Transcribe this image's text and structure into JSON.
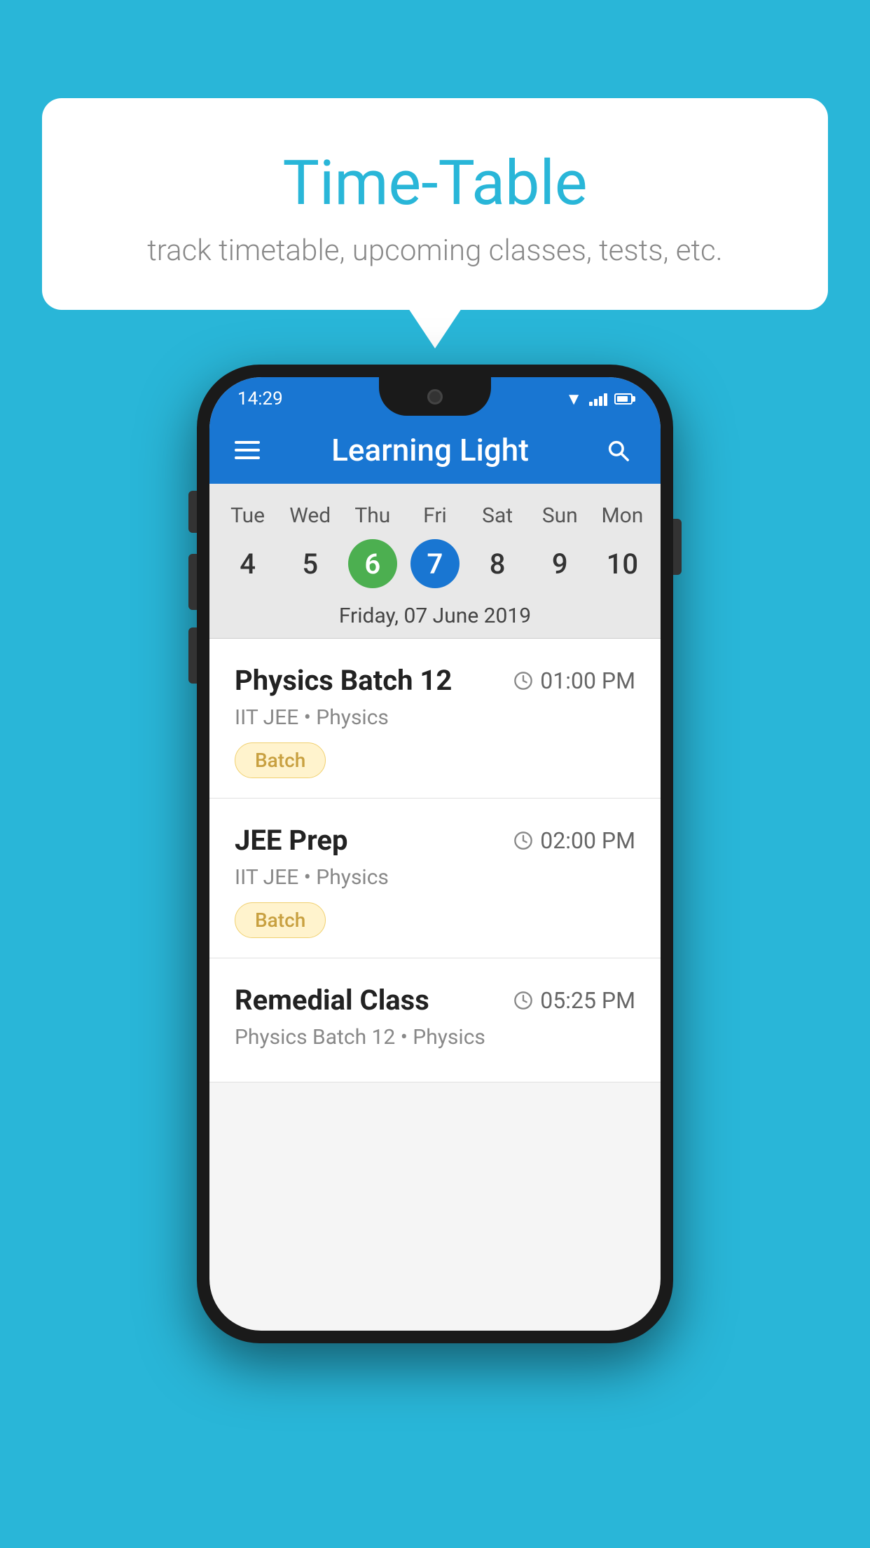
{
  "background_color": "#29B6D8",
  "bubble": {
    "title": "Time-Table",
    "subtitle": "track timetable, upcoming classes, tests, etc."
  },
  "phone": {
    "status_bar": {
      "time": "14:29"
    },
    "app_bar": {
      "title": "Learning Light"
    },
    "calendar": {
      "days": [
        "Tue",
        "Wed",
        "Thu",
        "Fri",
        "Sat",
        "Sun",
        "Mon"
      ],
      "dates": [
        "4",
        "5",
        "6",
        "7",
        "8",
        "9",
        "10"
      ],
      "today_index": 2,
      "selected_index": 3,
      "selected_label": "Friday, 07 June 2019"
    },
    "schedule": [
      {
        "title": "Physics Batch 12",
        "time": "01:00 PM",
        "subtitle": "IIT JEE • Physics",
        "badge": "Batch"
      },
      {
        "title": "JEE Prep",
        "time": "02:00 PM",
        "subtitle": "IIT JEE • Physics",
        "badge": "Batch"
      },
      {
        "title": "Remedial Class",
        "time": "05:25 PM",
        "subtitle": "Physics Batch 12 • Physics",
        "badge": ""
      }
    ]
  }
}
